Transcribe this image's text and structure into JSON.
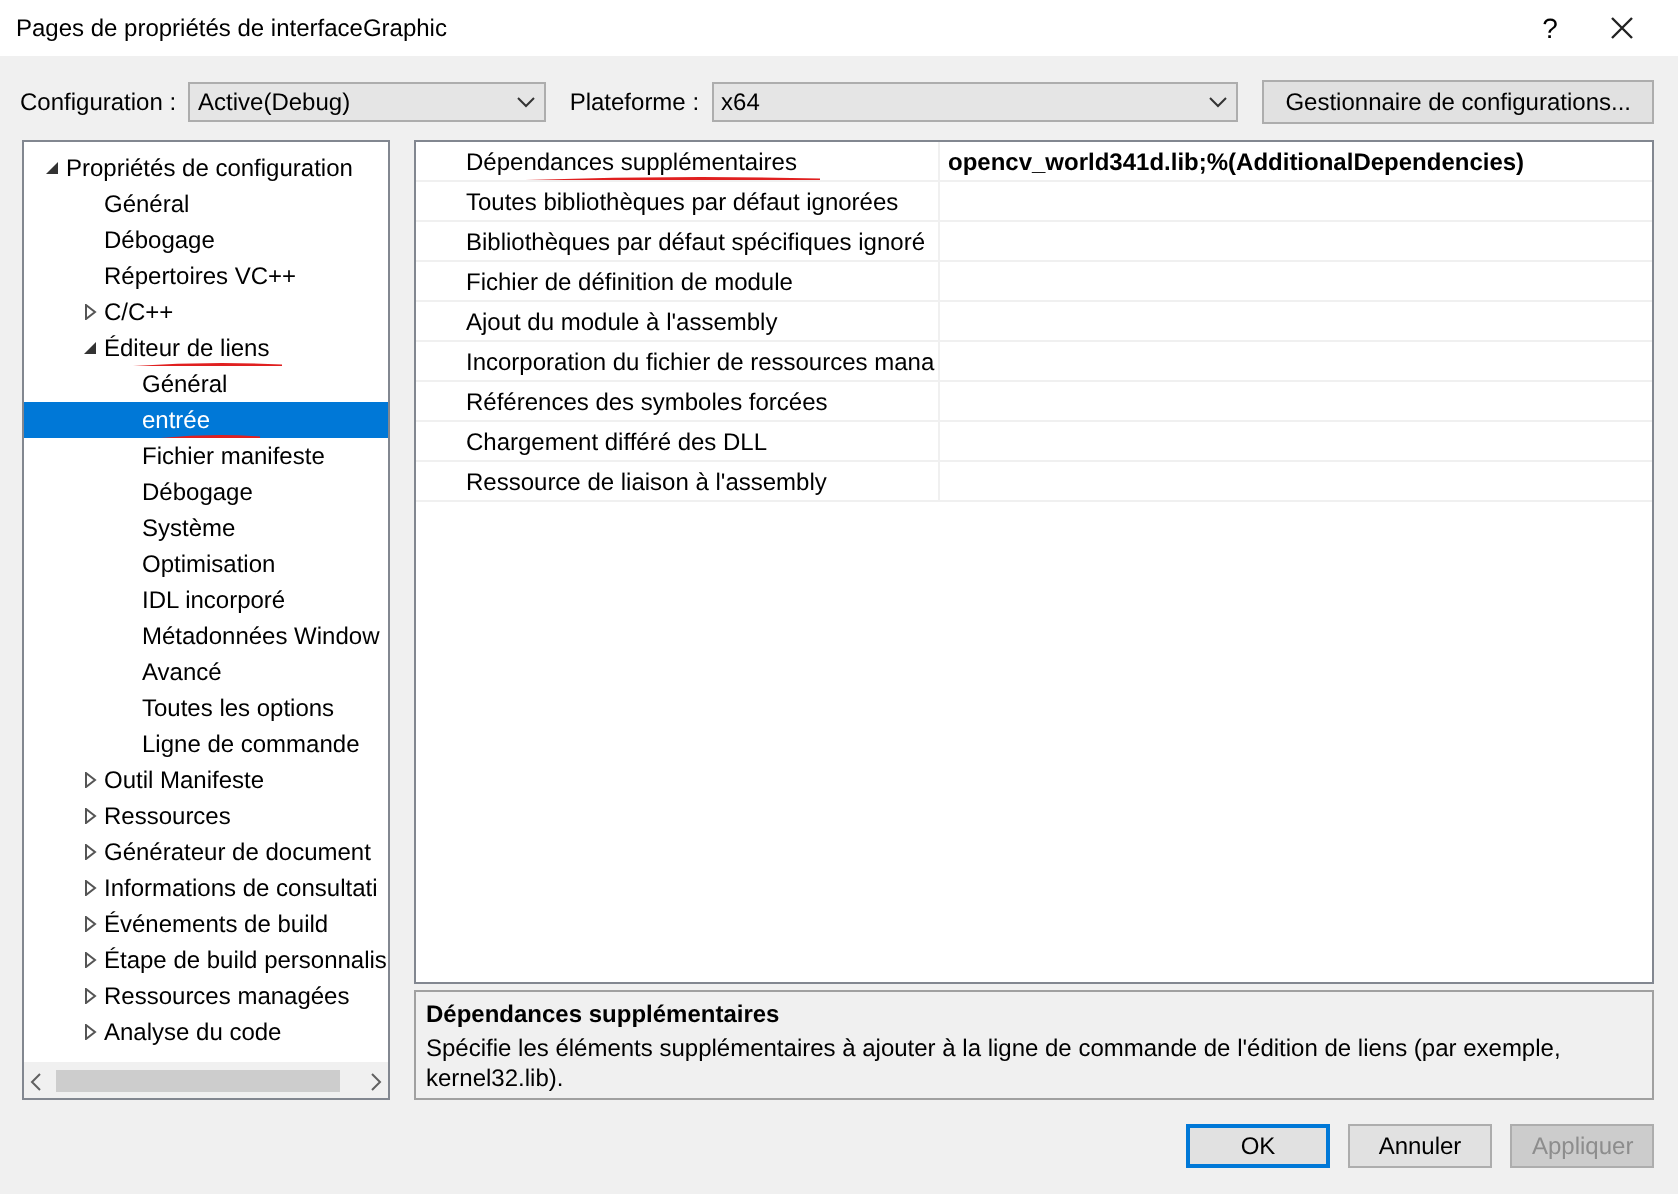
{
  "window": {
    "title": "Pages de propriétés de interfaceGraphic",
    "help": "?"
  },
  "toolbar": {
    "configuration_label": "Configuration :",
    "configuration": "Active(Debug)",
    "platform_label": "Plateforme :",
    "platform": "x64",
    "manager_button": "Gestionnaire de configurations..."
  },
  "tree": [
    {
      "label": "Propriétés de configuration",
      "expanded": true,
      "selected": false,
      "children": [
        {
          "label": "Général",
          "selected": false
        },
        {
          "label": "Débogage",
          "selected": false
        },
        {
          "label": "Répertoires VC++",
          "selected": false
        },
        {
          "label": "C/C++",
          "expanded": false,
          "selected": false
        },
        {
          "label": "Éditeur de liens",
          "expanded": true,
          "selected": false,
          "annotated": true,
          "children": [
            {
              "label": "Général",
              "selected": false
            },
            {
              "label": "entrée",
              "selected": true,
              "annotated": true
            },
            {
              "label": "Fichier manifeste",
              "selected": false
            },
            {
              "label": "Débogage",
              "selected": false
            },
            {
              "label": "Système",
              "selected": false
            },
            {
              "label": "Optimisation",
              "selected": false
            },
            {
              "label": "IDL incorporé",
              "selected": false
            },
            {
              "label": "Métadonnées Window",
              "selected": false
            },
            {
              "label": "Avancé",
              "selected": false
            },
            {
              "label": "Toutes les options",
              "selected": false
            },
            {
              "label": "Ligne de commande",
              "selected": false
            }
          ]
        },
        {
          "label": "Outil Manifeste",
          "expanded": false,
          "selected": false
        },
        {
          "label": "Ressources",
          "expanded": false,
          "selected": false
        },
        {
          "label": "Générateur de document",
          "expanded": false,
          "selected": false
        },
        {
          "label": "Informations de consultati",
          "expanded": false,
          "selected": false
        },
        {
          "label": "Événements de build",
          "expanded": false,
          "selected": false
        },
        {
          "label": "Étape de build personnalis",
          "expanded": false,
          "selected": false
        },
        {
          "label": "Ressources managées",
          "expanded": false,
          "selected": false
        },
        {
          "label": "Analyse du code",
          "expanded": false,
          "selected": false
        }
      ]
    }
  ],
  "properties": [
    {
      "name": "Dépendances supplémentaires",
      "value": "opencv_world341d.lib;%(AdditionalDependencies)",
      "annotated": true
    },
    {
      "name": "Toutes bibliothèques par défaut ignorées"
    },
    {
      "name": "Bibliothèques par défaut spécifiques ignoré"
    },
    {
      "name": "Fichier de définition de module"
    },
    {
      "name": "Ajout du module à l'assembly"
    },
    {
      "name": "Incorporation du fichier de ressources mana"
    },
    {
      "name": "Références des symboles forcées"
    },
    {
      "name": "Chargement différé des DLL"
    },
    {
      "name": "Ressource de liaison à l'assembly"
    }
  ],
  "description": {
    "title": "Dépendances supplémentaires",
    "text": "Spécifie les éléments supplémentaires à ajouter à la ligne de commande de l'édition de liens (par exemple, kernel32.lib)."
  },
  "buttons": [
    {
      "label": "OK",
      "default": true,
      "disabled": false
    },
    {
      "label": "Annuler",
      "default": false,
      "disabled": false
    },
    {
      "label": "Appliquer",
      "default": false,
      "disabled": true
    }
  ]
}
